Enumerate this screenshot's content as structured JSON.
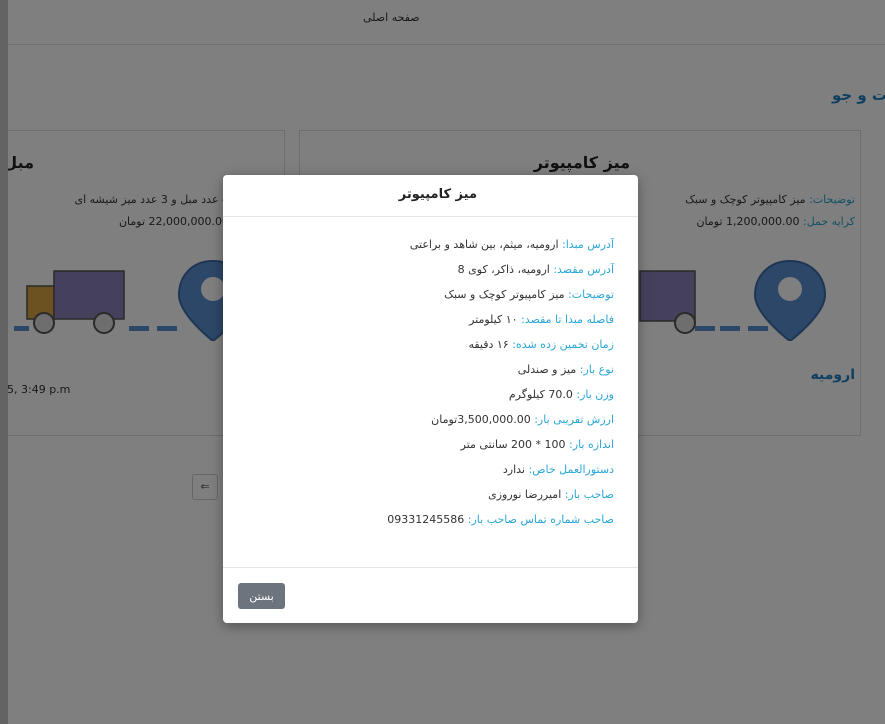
{
  "nav": {
    "home": "صفحه اصلی"
  },
  "section": {
    "title": "ت و جو"
  },
  "cards": [
    {
      "title": "میز کامپیوتر",
      "desc_label": "توضیحات:",
      "desc_value": "میز کامپیوتر کوچک و سبک",
      "fare_label": "کرایه حمل:",
      "fare_value": "1,200,000.00 تومان",
      "origin_city": "ارومیه"
    },
    {
      "title": "مبل",
      "desc_value": "4 عدد مبل و 3 عدد میز شیشه ای",
      "fare_value": "22,000,000.00 تومان",
      "time": "5, 3:49 p.m"
    }
  ],
  "pager": {
    "prev": "⇐"
  },
  "modal": {
    "title": "میز کامپیوتر",
    "rows": [
      {
        "label": "آدرس مبدا:",
        "value": "ارومیه، میثم، بین شاهد و براعتی"
      },
      {
        "label": "آدرس مقصد:",
        "value": "ارومیه، ذاکر، کوی 8"
      },
      {
        "label": "توضیحات:",
        "value": "میز کامپیوتر کوچک و سبک"
      },
      {
        "label": "فاصله مبدا تا مقصد:",
        "value": "۱۰ کیلومتر"
      },
      {
        "label": "زمان تخمین زده شده:",
        "value": "۱۶ دقیقه"
      },
      {
        "label": "نوع بار:",
        "value": "میز و صندلی"
      },
      {
        "label": "وزن بار:",
        "value": "70.0 کیلوگرم"
      },
      {
        "label": "ارزش تقریبی بار:",
        "value": "3,500,000.00تومان"
      },
      {
        "label": "اندازه بار:",
        "value": "100 * 200 سانتی متر"
      },
      {
        "label": "دستورالعمل خاص:",
        "value": "ندارد"
      },
      {
        "label": "صاحب بار:",
        "value": "امیررضا نوروزی"
      },
      {
        "label": "صاحب شماره تماس صاحب بار:",
        "value": "09331245586"
      }
    ],
    "close_label": "بستن"
  },
  "colors": {
    "accent": "#1f7fc2",
    "label": "#2aa6d6",
    "truck_cab": "#d9a441",
    "truck_box": "#8a82b8",
    "pin": "#5b8fd0"
  }
}
